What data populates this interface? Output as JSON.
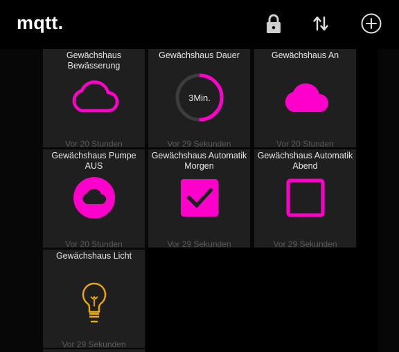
{
  "app": {
    "title": "mqtt."
  },
  "actions": {
    "lock": "lock-icon",
    "sort": "swap-vertical-icon",
    "add": "add-circle-icon"
  },
  "colors": {
    "accent": "#ff00cc",
    "bulb": "#f2a900",
    "tile": "#1f1f1f"
  },
  "tiles": [
    {
      "title": "Gewächshaus Bewässerung",
      "footer": "Vor 20 Stunden",
      "icon": "cloud-outline-icon"
    },
    {
      "title": "Gewächshaus Dauer",
      "footer": "Vor 29 Sekunden",
      "icon": "progress-ring",
      "value_label": "3Min.",
      "progress": 0.5
    },
    {
      "title": "Gewächshaus An",
      "footer": "Vor 20 Stunden",
      "icon": "cloud-filled-icon"
    },
    {
      "title": "Gewächshaus Pumpe AUS",
      "footer": "Vor 20 Stunden",
      "icon": "cloud-circle-icon"
    },
    {
      "title": "Gewächshaus Automatik Morgen",
      "footer": "Vor 29 Sekunden",
      "icon": "checkbox-checked-icon",
      "checked": true
    },
    {
      "title": "Gewächshaus Automatik Abend",
      "footer": "Vor 29 Sekunden",
      "icon": "checkbox-empty-icon",
      "checked": false
    },
    {
      "title": "Gewächshaus Licht",
      "footer": "Vor 29 Sekunden",
      "icon": "lightbulb-icon"
    }
  ]
}
